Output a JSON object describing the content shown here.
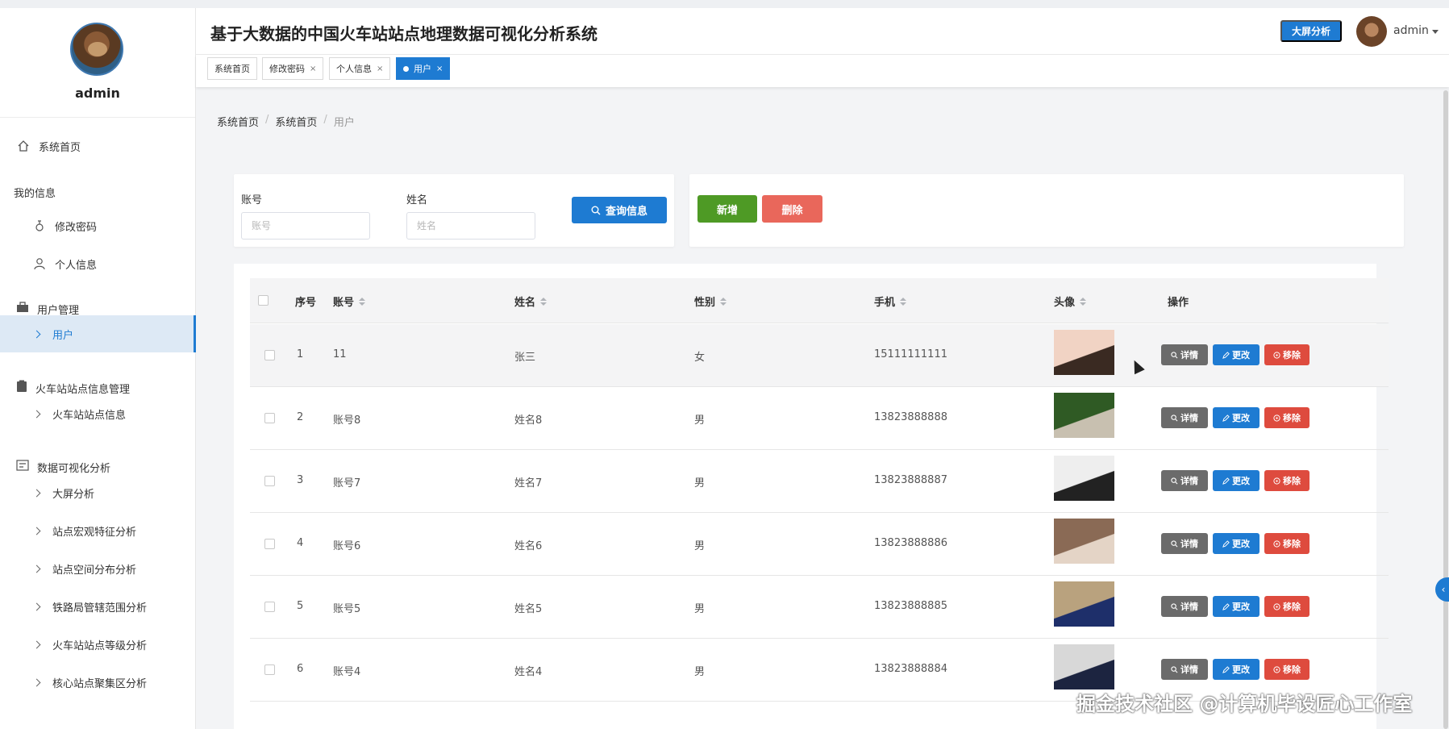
{
  "app": {
    "title": "基于大数据的中国火车站站点地理数据可视化分析系统",
    "big_screen_button": "大屏分析",
    "username": "admin"
  },
  "sidebar": {
    "profile_name": "admin",
    "home": "系统首页",
    "groups": [
      {
        "label": "我的信息",
        "items": [
          "修改密码",
          "个人信息"
        ]
      },
      {
        "label": "用户管理",
        "items": [
          "用户"
        ]
      },
      {
        "label": "火车站站点信息管理",
        "items": [
          "火车站站点信息"
        ]
      },
      {
        "label": "数据可视化分析",
        "items": [
          "大屏分析",
          "站点宏观特征分析",
          "站点空间分布分析",
          "铁路局管辖范围分析",
          "火车站站点等级分析",
          "核心站点聚集区分析"
        ]
      }
    ]
  },
  "tabs": [
    {
      "label": "系统首页"
    },
    {
      "label": "修改密码",
      "close": "×"
    },
    {
      "label": "个人信息",
      "close": "×"
    },
    {
      "label": "用户",
      "close": "×"
    }
  ],
  "breadcrumb": [
    "系统首页",
    "系统首页",
    "用户"
  ],
  "search": {
    "account_label": "账号",
    "account_placeholder": "账号",
    "name_label": "姓名",
    "name_placeholder": "姓名",
    "query_button": "查询信息"
  },
  "toolbar": {
    "add_button": "新增",
    "delete_button": "删除"
  },
  "table": {
    "headers": {
      "index": "序号",
      "account": "账号",
      "name": "姓名",
      "gender": "性别",
      "phone": "手机",
      "avatar": "头像",
      "actions": "操作"
    },
    "action_labels": {
      "detail": "详情",
      "edit": "更改",
      "remove": "移除"
    },
    "rows": [
      {
        "index": "1",
        "account": "11",
        "name": "张三",
        "gender": "女",
        "phone": "15111111111"
      },
      {
        "index": "2",
        "account": "账号8",
        "name": "姓名8",
        "gender": "男",
        "phone": "13823888888"
      },
      {
        "index": "3",
        "account": "账号7",
        "name": "姓名7",
        "gender": "男",
        "phone": "13823888887"
      },
      {
        "index": "4",
        "account": "账号6",
        "name": "姓名6",
        "gender": "男",
        "phone": "13823888886"
      },
      {
        "index": "5",
        "account": "账号5",
        "name": "姓名5",
        "gender": "男",
        "phone": "13823888885"
      },
      {
        "index": "6",
        "account": "账号4",
        "name": "姓名4",
        "gender": "男",
        "phone": "13823888884"
      }
    ]
  },
  "watermark": "掘金技术社区 @计算机毕设匠心工作室",
  "colors": {
    "primary": "#1e7bd2",
    "success": "#4e9a25",
    "danger": "#e9675b",
    "remove": "#de4b3e",
    "info": "#6b6b6b"
  }
}
